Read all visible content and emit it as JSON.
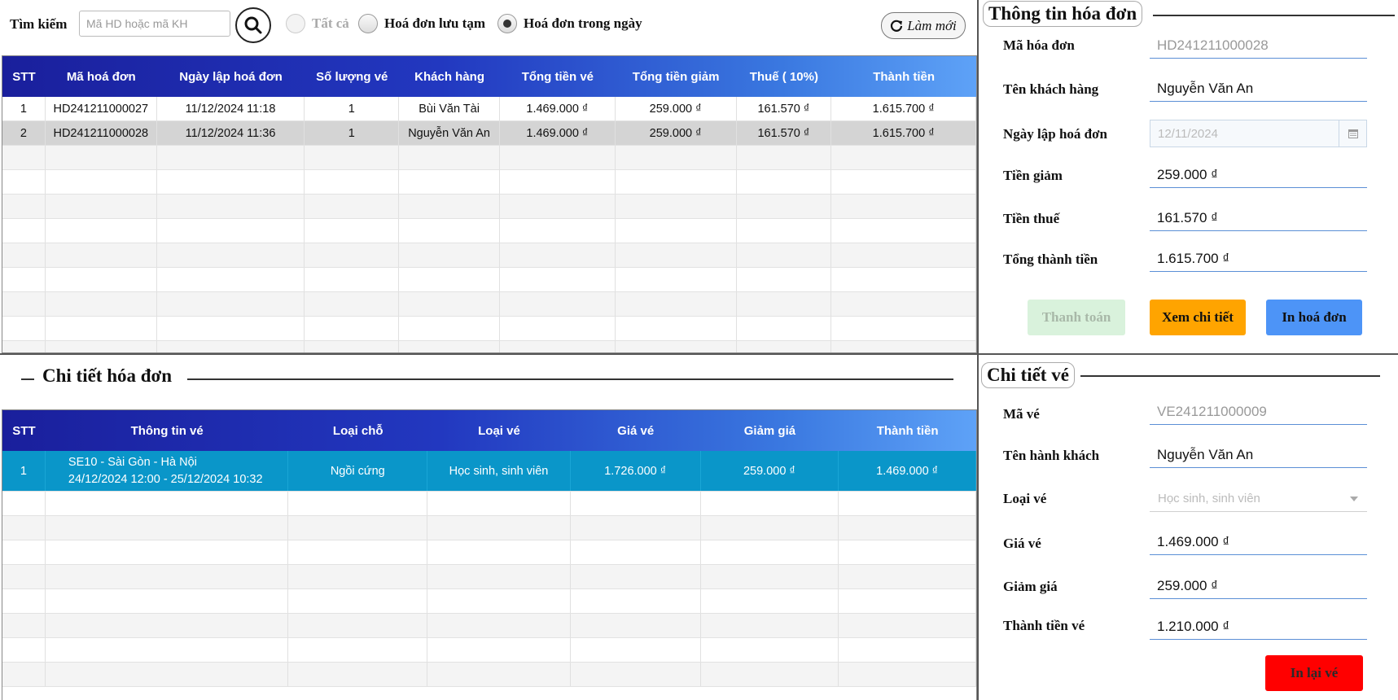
{
  "search": {
    "label": "Tìm kiếm",
    "placeholder": "Mã HD hoặc mã KH",
    "value": ""
  },
  "filters": [
    {
      "label": "Tất cả",
      "state": "disabled"
    },
    {
      "label": "Hoá đơn lưu tạm",
      "state": "unselected"
    },
    {
      "label": "Hoá đơn trong ngày",
      "state": "selected"
    }
  ],
  "refresh_label": "Làm mới",
  "invoice_table": {
    "headers": [
      "STT",
      "Mã hoá đơn",
      "Ngày lập hoá đơn",
      "Số lượng vé",
      "Khách hàng",
      "Tổng tiền vé",
      "Tổng tiền giảm",
      "Thuế ( 10%)",
      "Thành tiền"
    ],
    "rows": [
      [
        "1",
        "HD241211000027",
        "11/12/2024 11:18",
        "1",
        "Bùi Văn Tài",
        "1.469.000 ₫",
        "259.000 ₫",
        "161.570 ₫",
        "1.615.700 ₫"
      ],
      [
        "2",
        "HD241211000028",
        "11/12/2024 11:36",
        "1",
        "Nguyễn Văn An",
        "1.469.000 ₫",
        "259.000 ₫",
        "161.570 ₫",
        "1.615.700 ₫"
      ]
    ],
    "selected_row": 2
  },
  "invoice_detail_title": "Chi tiết hóa đơn",
  "detail_table": {
    "headers": [
      "STT",
      "Thông tin vé",
      "Loại chỗ",
      "Loại vé",
      "Giá vé",
      "Giảm giá",
      "Thành tiền"
    ],
    "rows": [
      [
        "1",
        "SE10 - Sài Gòn - Hà Nội",
        "24/12/2024 12:00 - 25/12/2024 10:32",
        "Ngồi cứng",
        "Học sinh, sinh viên",
        "1.726.000 ₫",
        "259.000 ₫",
        "1.469.000 ₫"
      ]
    ],
    "selected_row": 1
  },
  "invoice_info": {
    "title": "Thông tin hóa đơn",
    "fields": {
      "ma_label": "Mã hóa đơn",
      "ma_value": "HD241211000028",
      "ten_label": "Tên khách hàng",
      "ten_value": "Nguyễn Văn An",
      "ngay_label": "Ngày lập hoá đơn",
      "ngay_value": "12/11/2024",
      "giam_label": "Tiền giảm",
      "giam_value": "259.000 ₫",
      "thue_label": "Tiền thuế",
      "thue_value": "161.570 ₫",
      "tong_label": "Tổng thành tiền",
      "tong_value": "1.615.700 ₫"
    },
    "buttons": {
      "pay": "Thanh toán",
      "view": "Xem chi tiết",
      "print": "In hoá đơn"
    }
  },
  "ticket_info": {
    "title": "Chi tiết vé",
    "fields": {
      "ma_label": "Mã vé",
      "ma_value": "VE241211000009",
      "ten_label": "Tên hành khách",
      "ten_value": "Nguyễn Văn An",
      "loai_label": "Loại vé",
      "loai_value": "Học sinh, sinh viên",
      "gia_label": "Giá vé",
      "gia_value": "1.469.000 ₫",
      "giam_label": "Giảm giá",
      "giam_value": "259.000 ₫",
      "thanh_label": "Thành tiền vé",
      "thanh_value": "1.210.000 ₫"
    },
    "reprint_label": "In lại vé"
  },
  "colors": {
    "header_start": "#1a1f9c",
    "header_end": "#5ea2f7",
    "selected_blue": "#0a96c9",
    "button_view": "#ffa400",
    "button_print": "#4d94f7",
    "button_pay": "#d9f2dc",
    "button_reprint": "#ff0000"
  }
}
